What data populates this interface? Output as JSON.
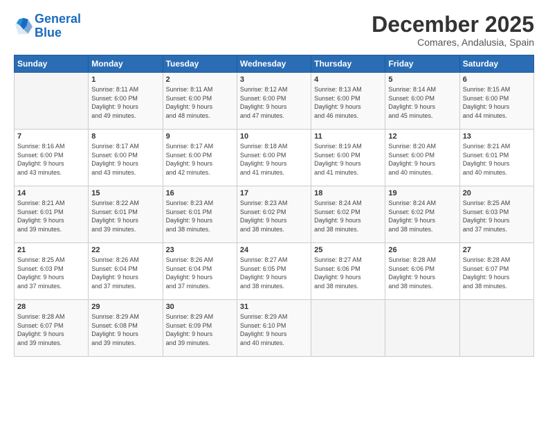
{
  "logo": {
    "line1": "General",
    "line2": "Blue"
  },
  "title": "December 2025",
  "subtitle": "Comares, Andalusia, Spain",
  "header_days": [
    "Sunday",
    "Monday",
    "Tuesday",
    "Wednesday",
    "Thursday",
    "Friday",
    "Saturday"
  ],
  "weeks": [
    [
      {
        "day": "",
        "info": ""
      },
      {
        "day": "1",
        "info": "Sunrise: 8:11 AM\nSunset: 6:00 PM\nDaylight: 9 hours\nand 49 minutes."
      },
      {
        "day": "2",
        "info": "Sunrise: 8:11 AM\nSunset: 6:00 PM\nDaylight: 9 hours\nand 48 minutes."
      },
      {
        "day": "3",
        "info": "Sunrise: 8:12 AM\nSunset: 6:00 PM\nDaylight: 9 hours\nand 47 minutes."
      },
      {
        "day": "4",
        "info": "Sunrise: 8:13 AM\nSunset: 6:00 PM\nDaylight: 9 hours\nand 46 minutes."
      },
      {
        "day": "5",
        "info": "Sunrise: 8:14 AM\nSunset: 6:00 PM\nDaylight: 9 hours\nand 45 minutes."
      },
      {
        "day": "6",
        "info": "Sunrise: 8:15 AM\nSunset: 6:00 PM\nDaylight: 9 hours\nand 44 minutes."
      }
    ],
    [
      {
        "day": "7",
        "info": "Sunrise: 8:16 AM\nSunset: 6:00 PM\nDaylight: 9 hours\nand 43 minutes."
      },
      {
        "day": "8",
        "info": "Sunrise: 8:17 AM\nSunset: 6:00 PM\nDaylight: 9 hours\nand 43 minutes."
      },
      {
        "day": "9",
        "info": "Sunrise: 8:17 AM\nSunset: 6:00 PM\nDaylight: 9 hours\nand 42 minutes."
      },
      {
        "day": "10",
        "info": "Sunrise: 8:18 AM\nSunset: 6:00 PM\nDaylight: 9 hours\nand 41 minutes."
      },
      {
        "day": "11",
        "info": "Sunrise: 8:19 AM\nSunset: 6:00 PM\nDaylight: 9 hours\nand 41 minutes."
      },
      {
        "day": "12",
        "info": "Sunrise: 8:20 AM\nSunset: 6:00 PM\nDaylight: 9 hours\nand 40 minutes."
      },
      {
        "day": "13",
        "info": "Sunrise: 8:21 AM\nSunset: 6:01 PM\nDaylight: 9 hours\nand 40 minutes."
      }
    ],
    [
      {
        "day": "14",
        "info": "Sunrise: 8:21 AM\nSunset: 6:01 PM\nDaylight: 9 hours\nand 39 minutes."
      },
      {
        "day": "15",
        "info": "Sunrise: 8:22 AM\nSunset: 6:01 PM\nDaylight: 9 hours\nand 39 minutes."
      },
      {
        "day": "16",
        "info": "Sunrise: 8:23 AM\nSunset: 6:01 PM\nDaylight: 9 hours\nand 38 minutes."
      },
      {
        "day": "17",
        "info": "Sunrise: 8:23 AM\nSunset: 6:02 PM\nDaylight: 9 hours\nand 38 minutes."
      },
      {
        "day": "18",
        "info": "Sunrise: 8:24 AM\nSunset: 6:02 PM\nDaylight: 9 hours\nand 38 minutes."
      },
      {
        "day": "19",
        "info": "Sunrise: 8:24 AM\nSunset: 6:02 PM\nDaylight: 9 hours\nand 38 minutes."
      },
      {
        "day": "20",
        "info": "Sunrise: 8:25 AM\nSunset: 6:03 PM\nDaylight: 9 hours\nand 37 minutes."
      }
    ],
    [
      {
        "day": "21",
        "info": "Sunrise: 8:25 AM\nSunset: 6:03 PM\nDaylight: 9 hours\nand 37 minutes."
      },
      {
        "day": "22",
        "info": "Sunrise: 8:26 AM\nSunset: 6:04 PM\nDaylight: 9 hours\nand 37 minutes."
      },
      {
        "day": "23",
        "info": "Sunrise: 8:26 AM\nSunset: 6:04 PM\nDaylight: 9 hours\nand 37 minutes."
      },
      {
        "day": "24",
        "info": "Sunrise: 8:27 AM\nSunset: 6:05 PM\nDaylight: 9 hours\nand 38 minutes."
      },
      {
        "day": "25",
        "info": "Sunrise: 8:27 AM\nSunset: 6:06 PM\nDaylight: 9 hours\nand 38 minutes."
      },
      {
        "day": "26",
        "info": "Sunrise: 8:28 AM\nSunset: 6:06 PM\nDaylight: 9 hours\nand 38 minutes."
      },
      {
        "day": "27",
        "info": "Sunrise: 8:28 AM\nSunset: 6:07 PM\nDaylight: 9 hours\nand 38 minutes."
      }
    ],
    [
      {
        "day": "28",
        "info": "Sunrise: 8:28 AM\nSunset: 6:07 PM\nDaylight: 9 hours\nand 39 minutes."
      },
      {
        "day": "29",
        "info": "Sunrise: 8:29 AM\nSunset: 6:08 PM\nDaylight: 9 hours\nand 39 minutes."
      },
      {
        "day": "30",
        "info": "Sunrise: 8:29 AM\nSunset: 6:09 PM\nDaylight: 9 hours\nand 39 minutes."
      },
      {
        "day": "31",
        "info": "Sunrise: 8:29 AM\nSunset: 6:10 PM\nDaylight: 9 hours\nand 40 minutes."
      },
      {
        "day": "",
        "info": ""
      },
      {
        "day": "",
        "info": ""
      },
      {
        "day": "",
        "info": ""
      }
    ]
  ]
}
